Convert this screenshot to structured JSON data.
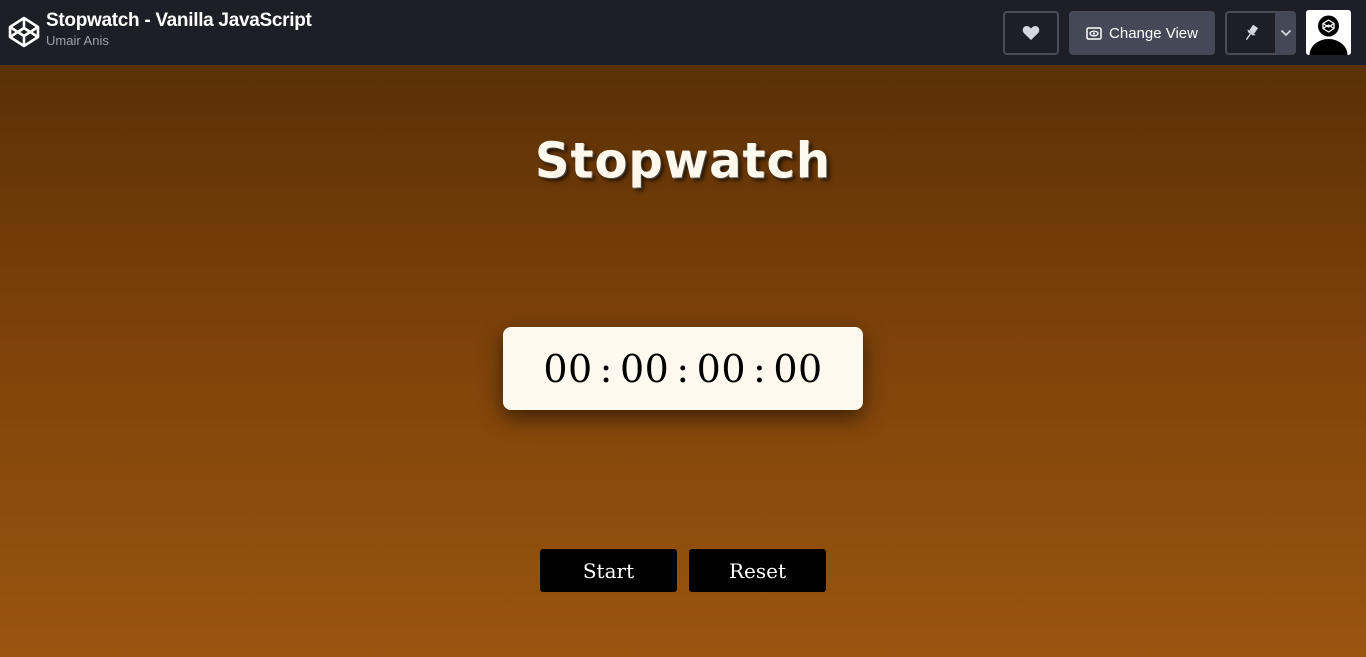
{
  "header": {
    "pen_title": "Stopwatch - Vanilla JavaScript",
    "author": "Umair Anis",
    "logo_icon": "codepen-logo-icon",
    "change_view_label": "Change View",
    "icons": {
      "heart": "heart-icon",
      "change_view": "eye-window-icon",
      "pin": "pin-icon",
      "dropdown": "chevron-down-icon",
      "avatar": "user-avatar"
    }
  },
  "app": {
    "heading": "Stopwatch",
    "time": {
      "hours": "00",
      "minutes": "00",
      "seconds": "00",
      "centiseconds": "00",
      "separator": ":"
    },
    "buttons": {
      "start": "Start",
      "reset": "Reset"
    }
  },
  "colors": {
    "topbar": "#1e1f26",
    "button_secondary": "#444857",
    "gradient_top": "#5a3005",
    "gradient_bottom": "#9a550f",
    "display_bg": "#fff9ef",
    "control_bg": "#000000"
  }
}
